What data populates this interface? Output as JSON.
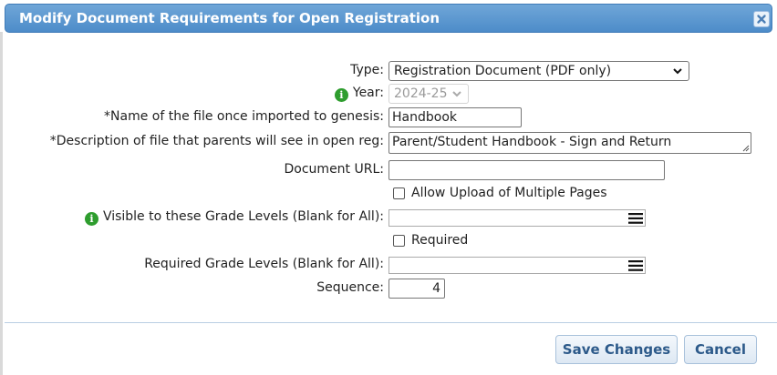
{
  "dialog": {
    "title": "Modify Document Requirements for Open Registration"
  },
  "form": {
    "type": {
      "label": "Type:",
      "value": "Registration Document (PDF only)"
    },
    "year": {
      "label": "Year:",
      "value": "2024-25"
    },
    "file_name": {
      "label": "*Name of the file once imported to genesis:",
      "value": "Handbook"
    },
    "description": {
      "label": "*Description of file that parents will see in open reg:",
      "value": "Parent/Student Handbook - Sign and Return"
    },
    "document_url": {
      "label": "Document URL:",
      "value": ""
    },
    "allow_upload": {
      "label": "Allow Upload of Multiple Pages",
      "checked": false
    },
    "visible_grades": {
      "label": "Visible to these Grade Levels (Blank for All):",
      "value": ""
    },
    "required": {
      "label": "Required",
      "checked": false
    },
    "required_grades": {
      "label": "Required Grade Levels (Blank for All):",
      "value": ""
    },
    "sequence": {
      "label": "Sequence:",
      "value": "4"
    }
  },
  "buttons": {
    "save": "Save Changes",
    "cancel": "Cancel"
  },
  "icons": {
    "close": "close-icon",
    "info": "info-icon",
    "menu": "hamburger-menu-icon",
    "caret": "chevron-down-icon"
  },
  "colors": {
    "titlebar": "#5a97d0",
    "info": "#2e9d2e",
    "button_text": "#2d5a8a"
  }
}
